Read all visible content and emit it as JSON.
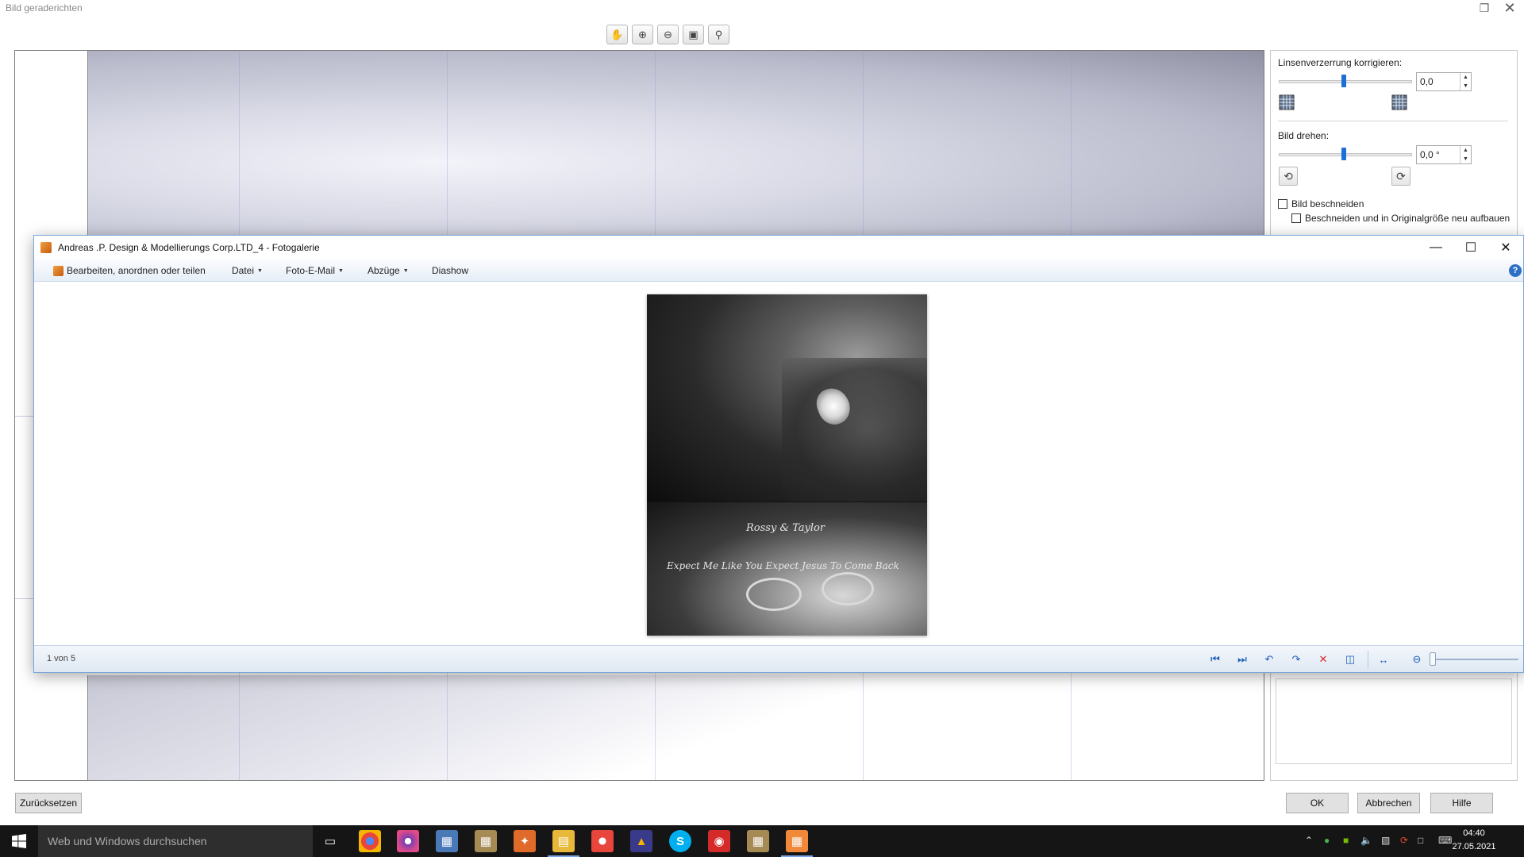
{
  "back_dialog": {
    "title": "Bild geraderichten",
    "restore_icon": "restore-icon",
    "close_icon": "close-icon",
    "toolbar": {
      "hand_icon": "hand-pan-icon",
      "zoom_in_icon": "zoom-in-icon",
      "zoom_out_icon": "zoom-out-icon",
      "fit_icon": "fit-to-window-icon",
      "actual_size_icon": "actual-size-icon"
    },
    "panel": {
      "lens_label": "Linsenverzerrung korrigieren:",
      "lens_value": "0,0",
      "rotate_label": "Bild drehen:",
      "rotate_value": "0,0 °",
      "crop_label": "Bild beschneiden",
      "crop_checked": false,
      "crop_rebuild_label": "Beschneiden und in Originalgröße neu aufbauen",
      "crop_rebuild_checked": false
    },
    "buttons": {
      "reset": "Zurücksetzen",
      "ok": "OK",
      "cancel": "Abbrechen",
      "help": "Hilfe"
    }
  },
  "gallery": {
    "title": "Andreas .P. Design & Modellierungs Corp.LTD_4 - Fotogalerie",
    "menu": {
      "edit": "Bearbeiten, anordnen oder teilen",
      "file": "Datei",
      "email": "Foto-E-Mail",
      "prints": "Abzüge",
      "slideshow": "Diashow"
    },
    "photo_text": {
      "line1": "Rossy & Taylor",
      "line2": "Expect Me Like You Expect Jesus To Come Back"
    },
    "status": {
      "counter": "1 von 5"
    }
  },
  "taskbar": {
    "search_placeholder": "Web und Windows durchsuchen",
    "time": "04:40",
    "date": "27.05.2021"
  },
  "colors": {
    "accent_blue": "#1c6fd6",
    "taskbar_bg": "#151515",
    "gallery_bar": "#dfe8f3"
  }
}
